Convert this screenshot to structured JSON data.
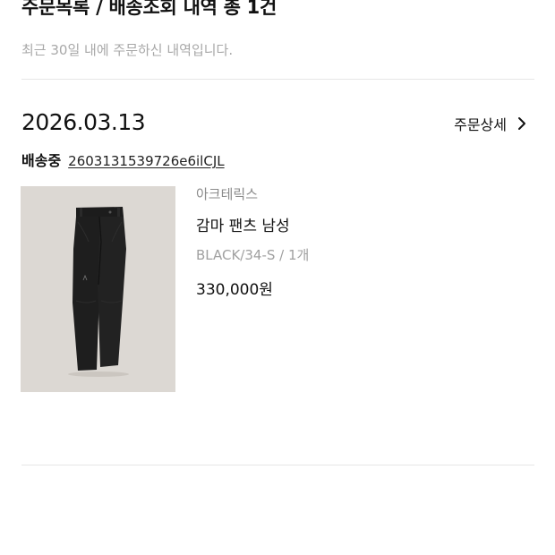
{
  "header": {
    "title": "주문목록 / 배송조회 내역 총 1건",
    "subtitle": "최근 30일 내에 주문하신 내역입니다."
  },
  "order": {
    "date": "2026.03.13",
    "detail_label": "주문상세",
    "status": "배송중",
    "order_number": "2603131539726e6ilCJL",
    "items": [
      {
        "brand": "아크테릭스",
        "name": "감마 팬츠 남성",
        "option": "BLACK/34-S / 1개",
        "price": "330,000원",
        "image_icon": "black-pants-photo"
      }
    ]
  },
  "colors": {
    "text": "#111111",
    "muted": "#a8a8a8",
    "divider": "#e6e6e6",
    "image_bg": "#dcd8d3"
  }
}
